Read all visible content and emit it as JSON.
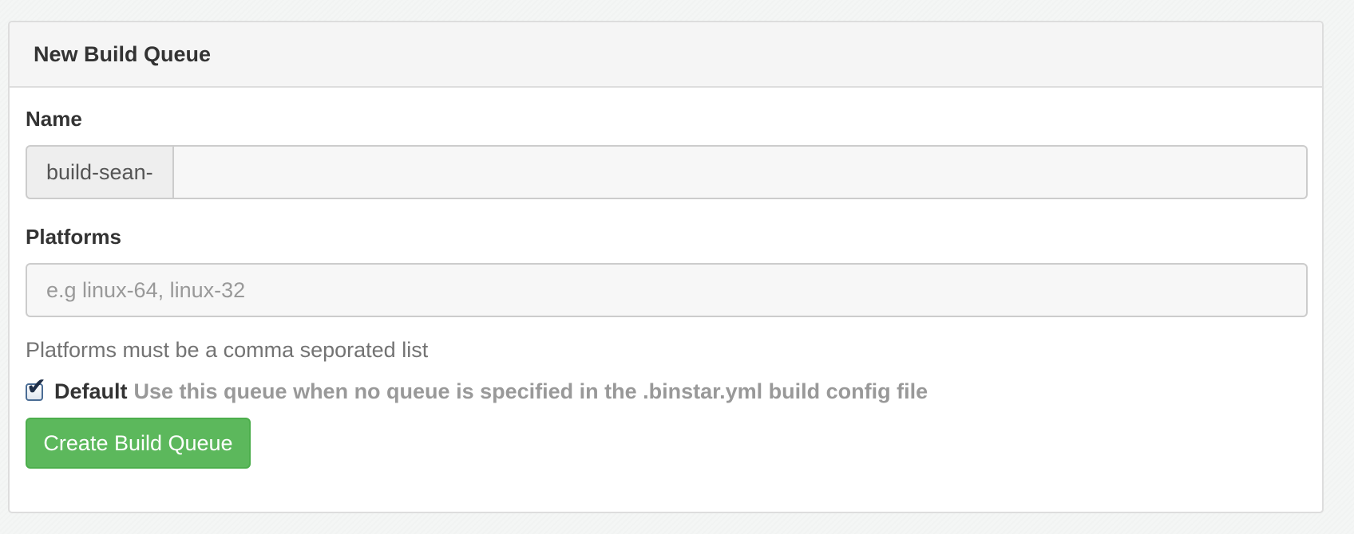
{
  "panel": {
    "title": "New Build Queue"
  },
  "form": {
    "name": {
      "label": "Name",
      "prefix": "build-sean-",
      "value": ""
    },
    "platforms": {
      "label": "Platforms",
      "placeholder": "e.g linux-64, linux-32",
      "value": "",
      "help_text": "Platforms must be a comma seporated list"
    },
    "default": {
      "checked": true,
      "label": "Default",
      "description": "Use this queue when no queue is specified in the .binstar.yml build config file"
    },
    "submit_label": "Create Build Queue"
  },
  "colors": {
    "primary_button": "#5cb85c",
    "heading_bg": "#f5f5f5",
    "help_text": "#737373",
    "muted_text": "#999999"
  }
}
